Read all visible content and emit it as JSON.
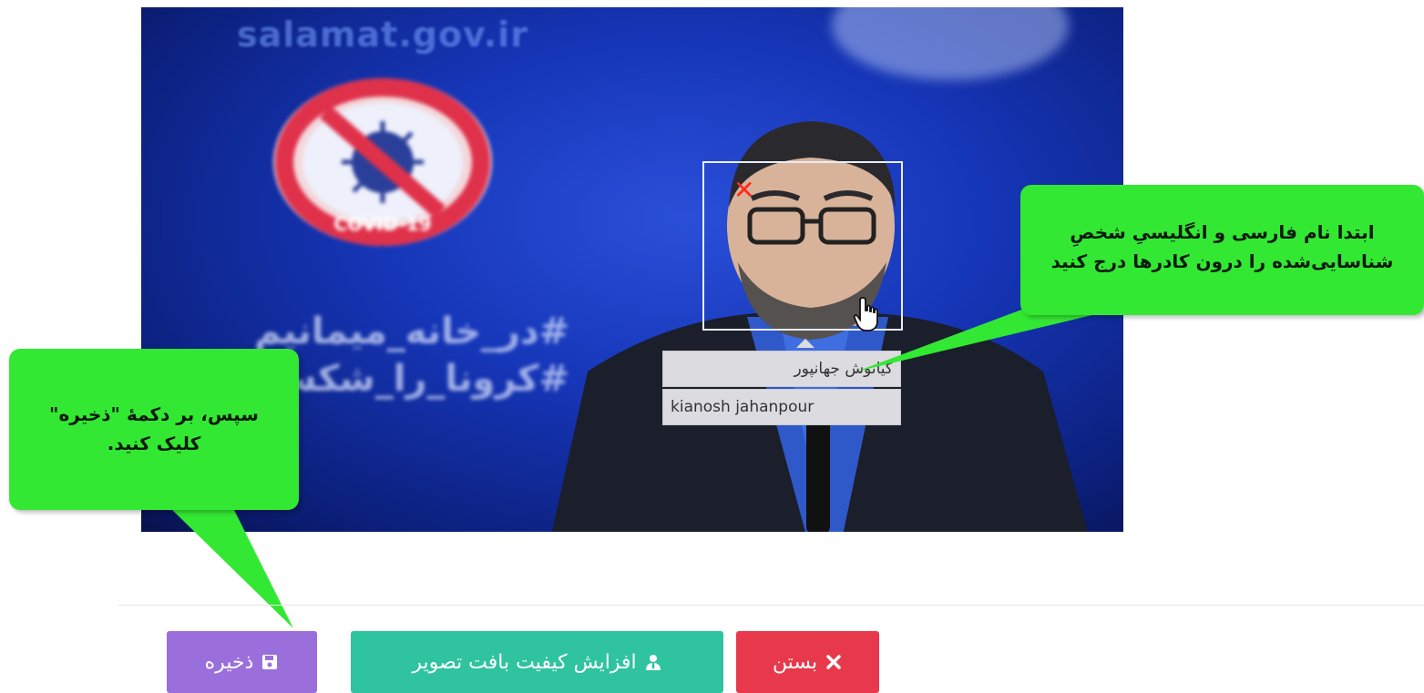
{
  "photo": {
    "watermark": "salamat.gov.ir",
    "covid_sign_text": "COVID-19",
    "hashtag_line1": "#در_خانه_میمانیم",
    "hashtag_line2": "#کرونا_را_شکست_"
  },
  "face_tag": {
    "remove_glyph": "✕",
    "name_fa": "کیانوش جهانپور",
    "name_en": "kianosh jahanpour"
  },
  "callouts": {
    "right_line1": "ابتدا نام فارسی و انگلیسیِ شخصِ",
    "right_line2": "شناسایی‌شده را درون کادرها درج کنید",
    "left_line1": "سپس، بر دکمهٔ \"ذخیره\"",
    "left_line2": "کلیک کنید."
  },
  "buttons": {
    "save_label": "ذخیره",
    "enhance_label": "افزایش کیفیت بافت تصویر",
    "close_label": "بستن"
  },
  "colors": {
    "callout": "#33e833",
    "save": "#9a6fdc",
    "enhance": "#2fc3a0",
    "close": "#e8394c",
    "remove": "#ff2a1a"
  },
  "icons": {
    "save": "floppy-disk-icon",
    "enhance": "user-tie-icon",
    "close": "close-icon",
    "remove": "close-icon",
    "cursor": "hand-pointer-icon"
  }
}
